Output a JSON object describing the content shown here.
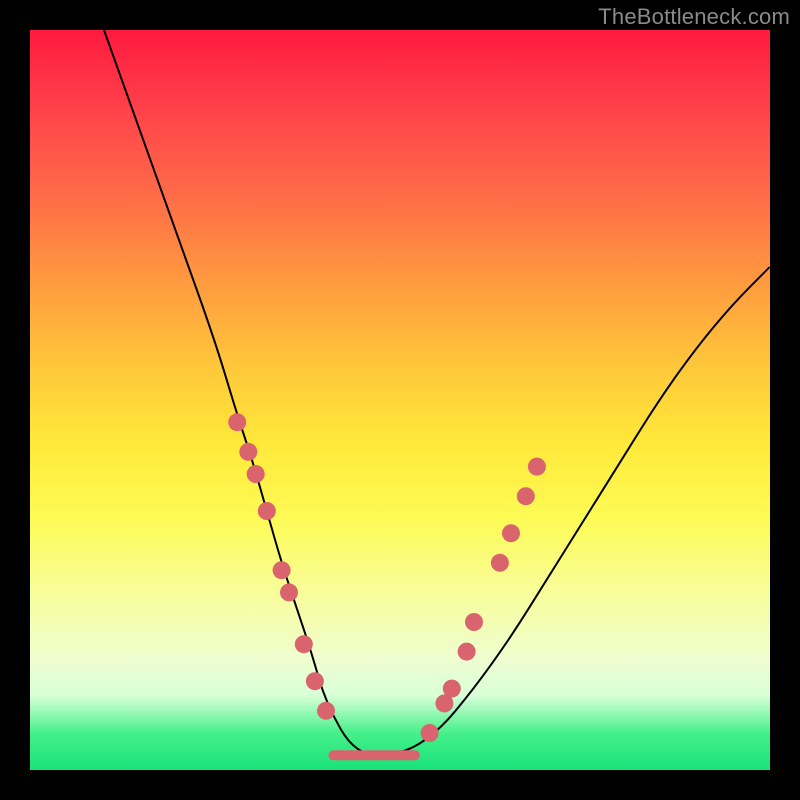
{
  "watermark": "TheBottleneck.com",
  "chart_data": {
    "type": "line",
    "title": "",
    "xlabel": "",
    "ylabel": "",
    "xlim": [
      0,
      100
    ],
    "ylim": [
      0,
      100
    ],
    "grid": false,
    "legend": false,
    "series": [
      {
        "name": "curve",
        "x": [
          10,
          15,
          20,
          25,
          28,
          30,
          32,
          34,
          36,
          38,
          40,
          44,
          50,
          55,
          60,
          65,
          70,
          75,
          80,
          85,
          90,
          95,
          100
        ],
        "y": [
          100,
          86,
          72,
          58,
          48,
          42,
          35,
          28,
          22,
          16,
          9,
          2,
          2,
          5,
          11,
          18,
          26,
          34,
          42,
          50,
          57,
          63,
          68
        ]
      }
    ],
    "flat_segment": {
      "x_start": 41,
      "x_end": 52,
      "y": 2
    },
    "dots_left": [
      {
        "x": 28.0,
        "y": 47
      },
      {
        "x": 29.5,
        "y": 43
      },
      {
        "x": 30.5,
        "y": 40
      },
      {
        "x": 32.0,
        "y": 35
      },
      {
        "x": 34.0,
        "y": 27
      },
      {
        "x": 35.0,
        "y": 24
      },
      {
        "x": 37.0,
        "y": 17
      },
      {
        "x": 38.5,
        "y": 12
      },
      {
        "x": 40.0,
        "y": 8
      }
    ],
    "dots_right": [
      {
        "x": 54.0,
        "y": 5
      },
      {
        "x": 56.0,
        "y": 9
      },
      {
        "x": 57.0,
        "y": 11
      },
      {
        "x": 59.0,
        "y": 16
      },
      {
        "x": 60.0,
        "y": 20
      },
      {
        "x": 63.5,
        "y": 28
      },
      {
        "x": 65.0,
        "y": 32
      },
      {
        "x": 67.0,
        "y": 37
      },
      {
        "x": 68.5,
        "y": 41
      }
    ],
    "colors": {
      "dot": "#d9646e",
      "curve": "#000000",
      "gradient_top": "#ff1a3f",
      "gradient_bottom": "#19e27a"
    }
  }
}
